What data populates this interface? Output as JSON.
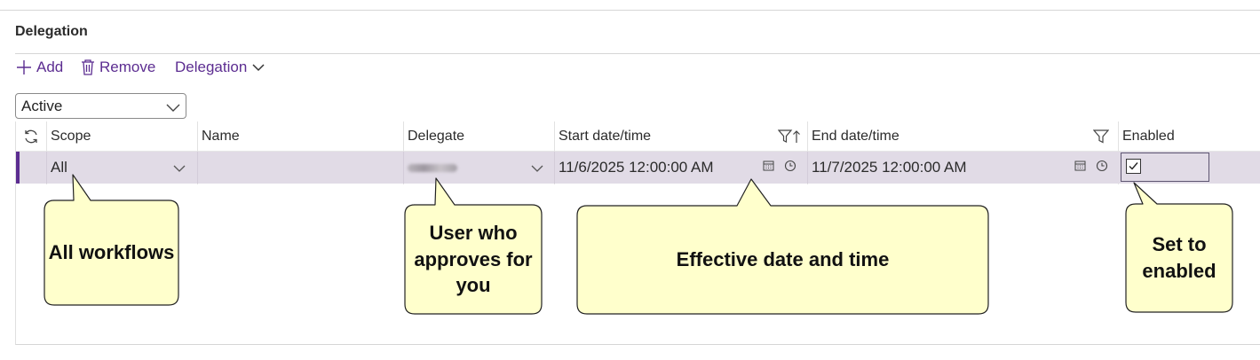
{
  "section": {
    "title": "Delegation"
  },
  "toolbar": {
    "add_label": "Add",
    "remove_label": "Remove",
    "delegation_label": "Delegation"
  },
  "filter": {
    "selected": "Active"
  },
  "grid": {
    "columns": {
      "scope": "Scope",
      "name": "Name",
      "delegate": "Delegate",
      "start": "Start date/time",
      "end": "End date/time",
      "enabled": "Enabled"
    },
    "row": {
      "scope": "All",
      "name": "",
      "start": "11/6/2025 12:00:00 AM",
      "end": "11/7/2025 12:00:00 AM",
      "enabled": true
    }
  },
  "callouts": {
    "scope": "All workflows",
    "delegate": "User who approves for you",
    "dates": "Effective date and time",
    "enabled": "Set to enabled"
  },
  "colors": {
    "accent": "#5c2d91",
    "row_selected": "#e1dbe6",
    "callout_fill": "#ffffcc"
  }
}
